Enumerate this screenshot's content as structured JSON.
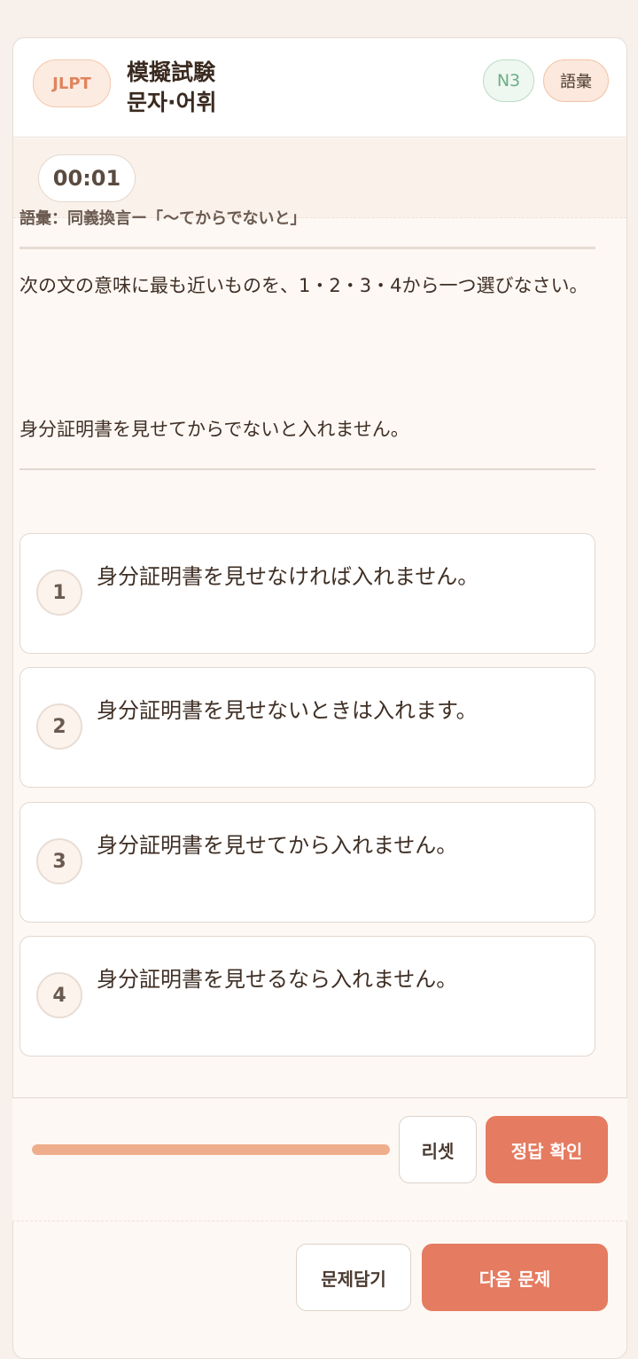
{
  "header": {
    "badge": "JLPT",
    "title_line1": "模擬試験",
    "title_line2": "문자·어휘",
    "level": "N3",
    "category": "語彙"
  },
  "timer": "00:01",
  "question": {
    "section": "語彙：同義換言ー「〜てからでないと」",
    "instruction": "次の文の意味に最も近いものを、1・2・3・4から一つ選びなさい。",
    "sentence": "身分証明書を見せてからでないと入れません。"
  },
  "options": [
    {
      "num": "1",
      "text": "身分証明書を見せなければ入れません。"
    },
    {
      "num": "2",
      "text": "身分証明書を見せないときは入れます。"
    },
    {
      "num": "3",
      "text": "身分証明書を見せてから入れません。"
    },
    {
      "num": "4",
      "text": "身分証明書を見せるなら入れません。"
    }
  ],
  "progress": {
    "percent": 100
  },
  "actions": {
    "reset": "리셋",
    "check": "정답 확인",
    "save": "문제담기",
    "next": "다음 문제"
  },
  "colors": {
    "accent": "#e57b60",
    "progress": "#eeae8c",
    "level_green": "#6fae86"
  }
}
